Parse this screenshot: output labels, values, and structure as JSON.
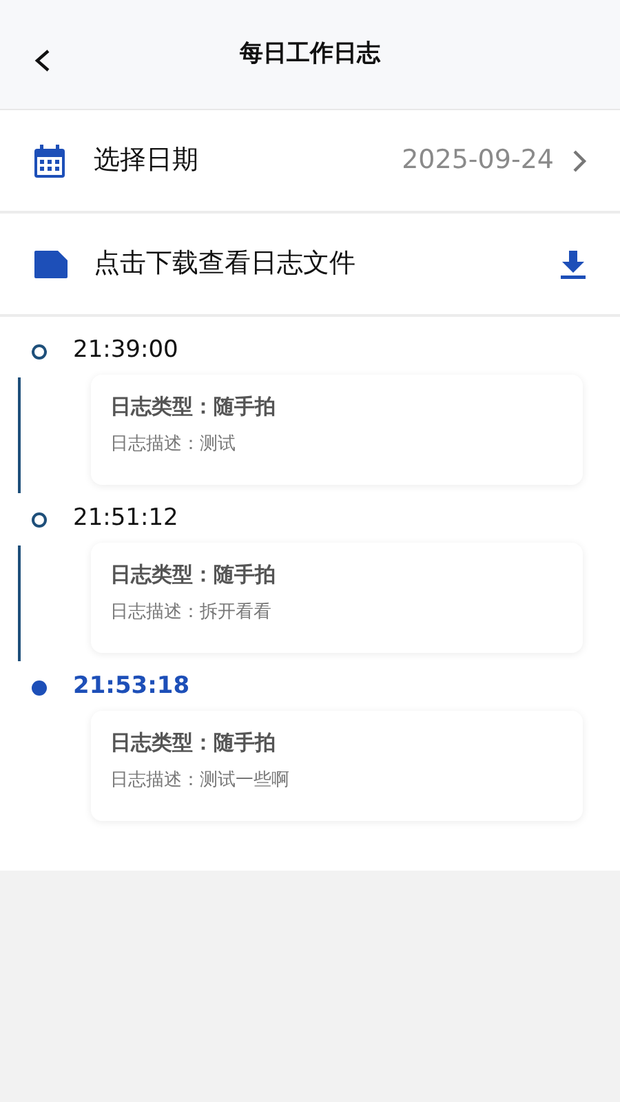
{
  "header": {
    "title": "每日工作日志"
  },
  "date_row": {
    "label": "选择日期",
    "value": "2025-09-24"
  },
  "download_row": {
    "label": "点击下载查看日志文件"
  },
  "entries": [
    {
      "time": "21:39:00",
      "selected": false,
      "type": "日志类型：随手拍",
      "description": "日志描述：测试"
    },
    {
      "time": "21:51:12",
      "selected": false,
      "type": "日志类型：随手拍",
      "description": "日志描述：拆开看看"
    },
    {
      "time": "21:53:18",
      "selected": true,
      "type": "日志类型：随手拍",
      "description": "日志描述：测试一些啊"
    }
  ]
}
